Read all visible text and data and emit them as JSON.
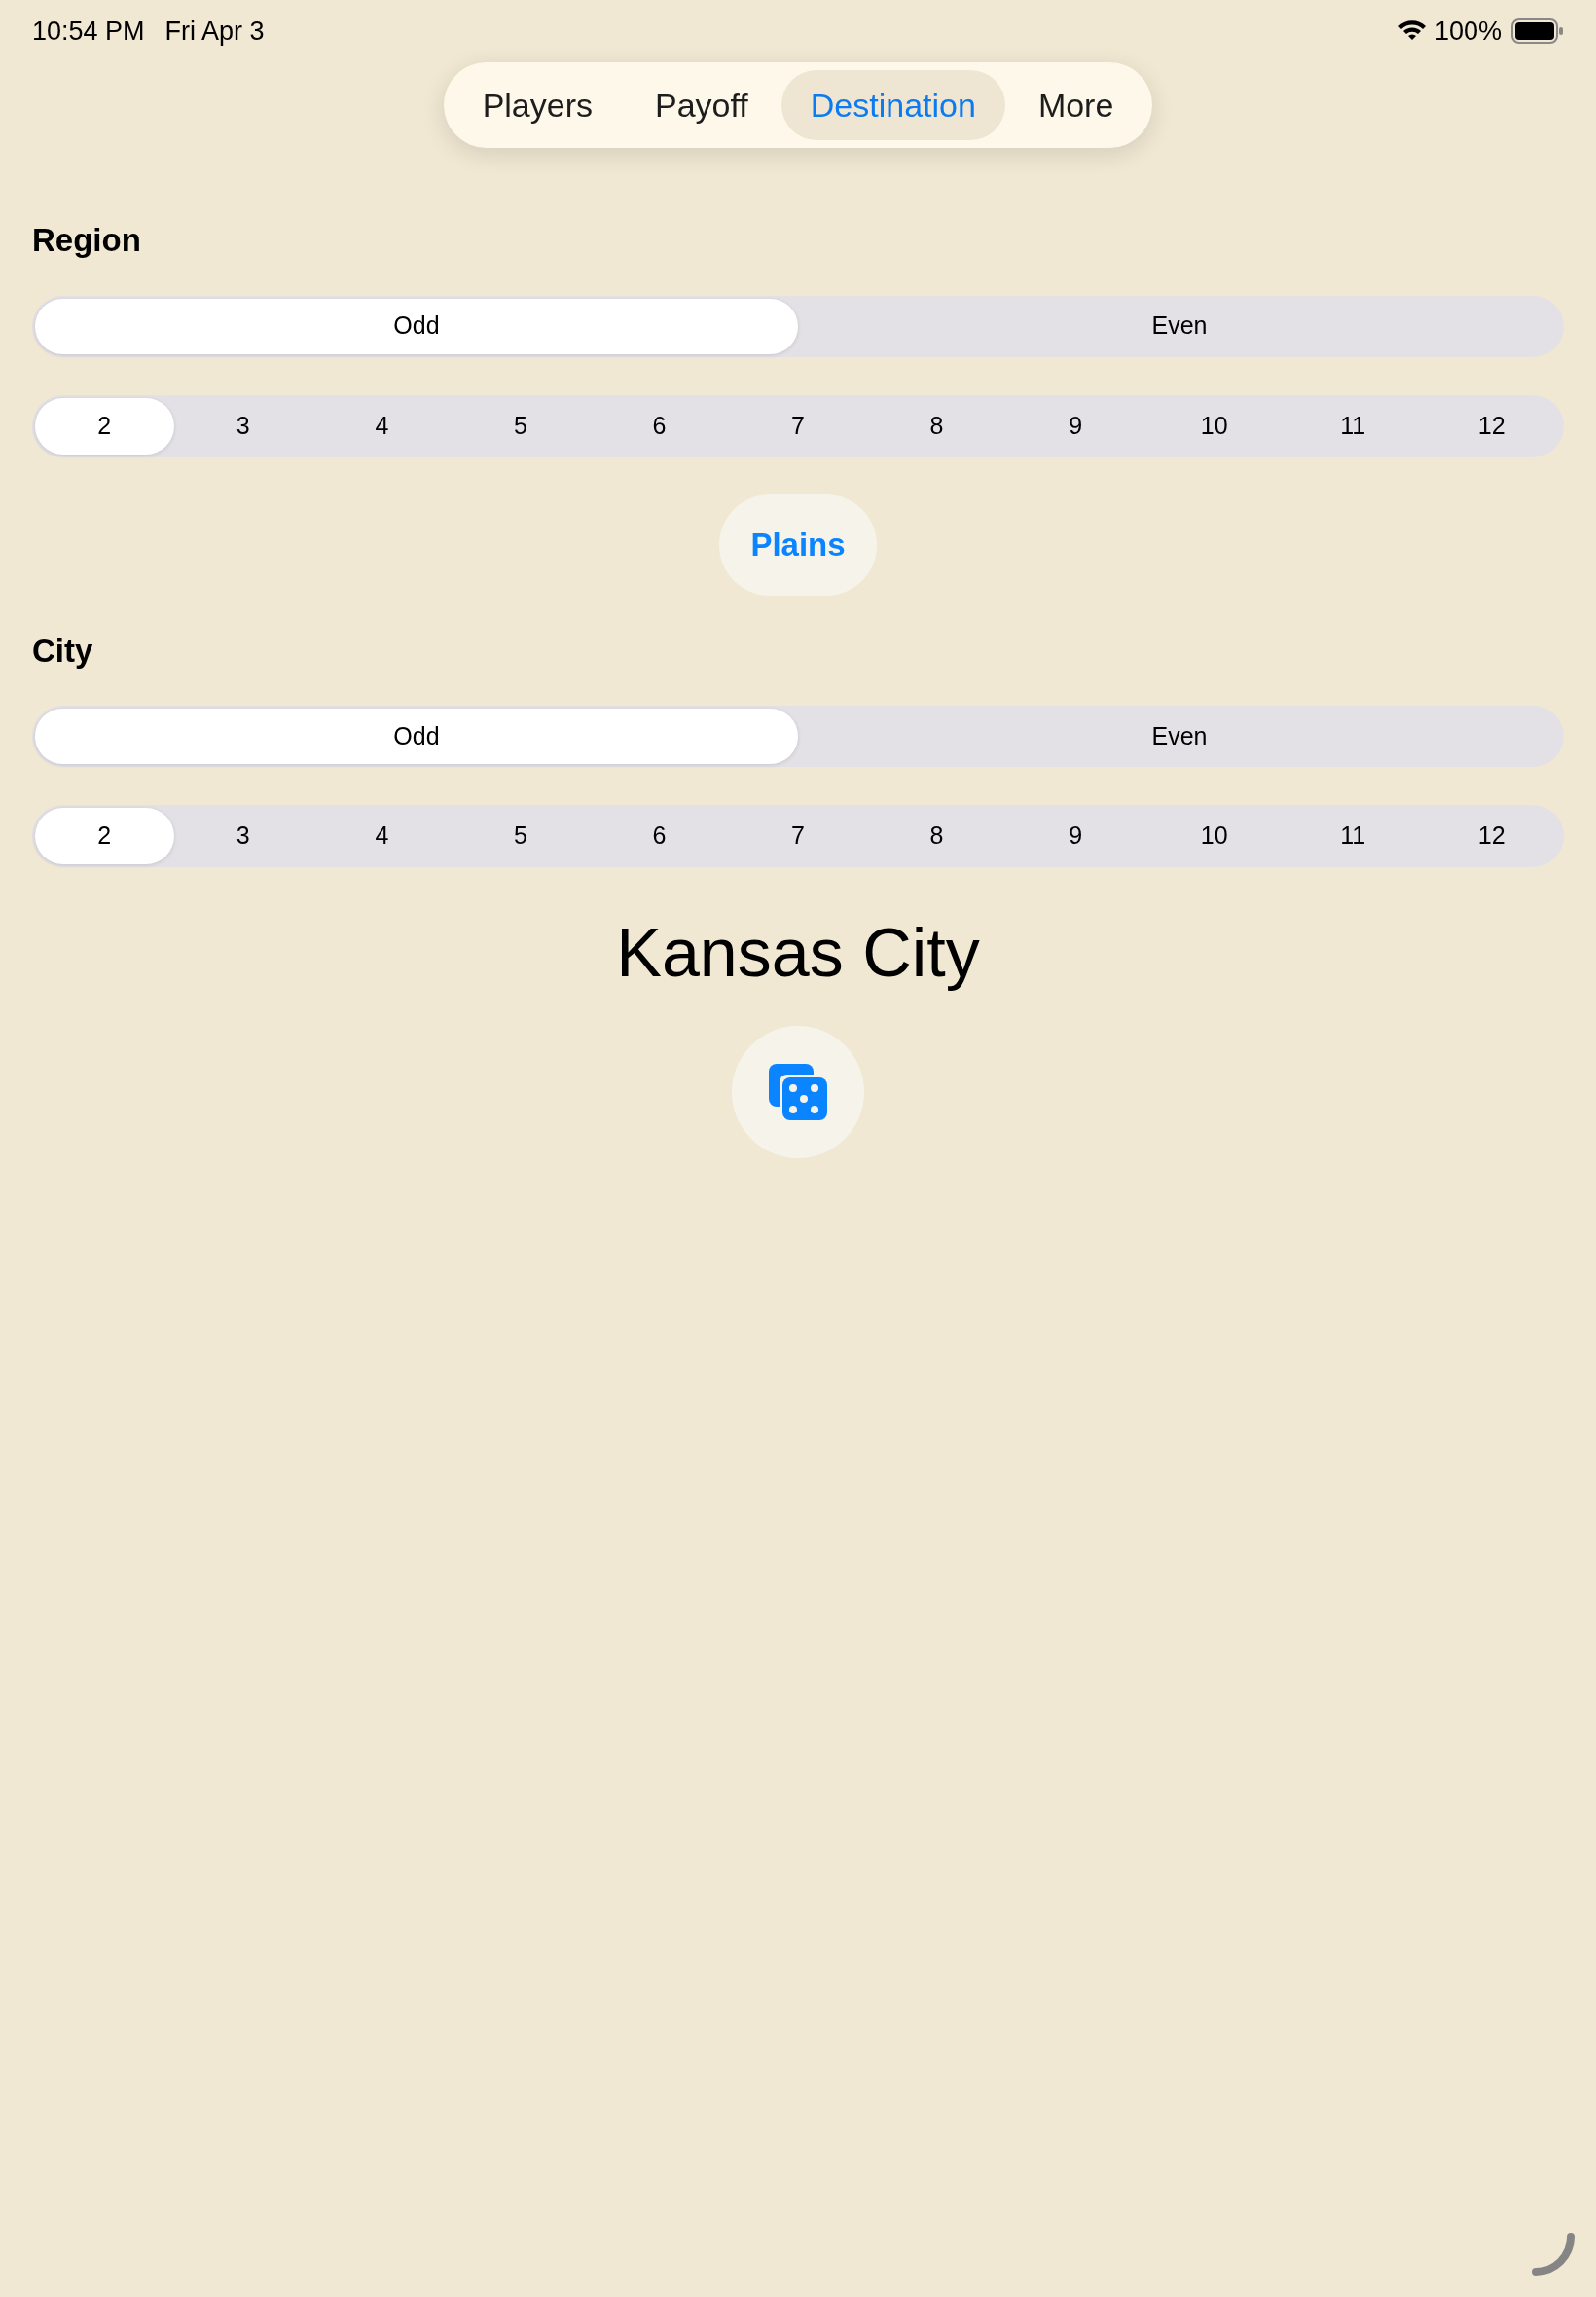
{
  "status_bar": {
    "time": "10:54 PM",
    "date": "Fri Apr 3",
    "battery": "100%"
  },
  "tabs": [
    {
      "label": "Players",
      "selected": false
    },
    {
      "label": "Payoff",
      "selected": false
    },
    {
      "label": "Destination",
      "selected": true
    },
    {
      "label": "More",
      "selected": false
    }
  ],
  "region": {
    "title": "Region",
    "parity": [
      {
        "label": "Odd",
        "selected": true
      },
      {
        "label": "Even",
        "selected": false
      }
    ],
    "numbers": [
      {
        "label": "2",
        "selected": true
      },
      {
        "label": "3",
        "selected": false
      },
      {
        "label": "4",
        "selected": false
      },
      {
        "label": "5",
        "selected": false
      },
      {
        "label": "6",
        "selected": false
      },
      {
        "label": "7",
        "selected": false
      },
      {
        "label": "8",
        "selected": false
      },
      {
        "label": "9",
        "selected": false
      },
      {
        "label": "10",
        "selected": false
      },
      {
        "label": "11",
        "selected": false
      },
      {
        "label": "12",
        "selected": false
      }
    ],
    "result_button": "Plains"
  },
  "city": {
    "title": "City",
    "parity": [
      {
        "label": "Odd",
        "selected": true
      },
      {
        "label": "Even",
        "selected": false
      }
    ],
    "numbers": [
      {
        "label": "2",
        "selected": true
      },
      {
        "label": "3",
        "selected": false
      },
      {
        "label": "4",
        "selected": false
      },
      {
        "label": "5",
        "selected": false
      },
      {
        "label": "6",
        "selected": false
      },
      {
        "label": "7",
        "selected": false
      },
      {
        "label": "8",
        "selected": false
      },
      {
        "label": "9",
        "selected": false
      },
      {
        "label": "10",
        "selected": false
      },
      {
        "label": "11",
        "selected": false
      },
      {
        "label": "12",
        "selected": false
      }
    ],
    "result_text": "Kansas City"
  }
}
